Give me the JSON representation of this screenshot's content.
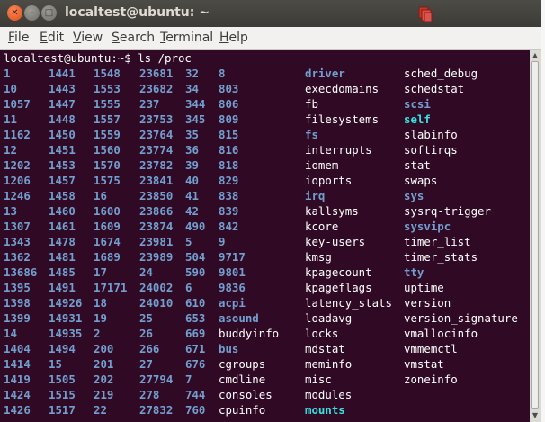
{
  "window": {
    "title": "localtest@ubuntu: ~",
    "close_symbol": "✕",
    "minimize_symbol": "–",
    "maximize_symbol": "□"
  },
  "menu": [
    {
      "id": "file",
      "prefix": "",
      "ul": "F",
      "rest": "ile"
    },
    {
      "id": "edit",
      "prefix": "",
      "ul": "E",
      "rest": "dit"
    },
    {
      "id": "view",
      "prefix": "",
      "ul": "V",
      "rest": "iew"
    },
    {
      "id": "search",
      "prefix": "",
      "ul": "S",
      "rest": "earch"
    },
    {
      "id": "terminal",
      "prefix": "",
      "ul": "T",
      "rest": "erminal"
    },
    {
      "id": "help",
      "prefix": "",
      "ul": "H",
      "rest": "elp"
    }
  ],
  "terminal": {
    "prompt": "localtest@ubuntu:~$ ls /proc",
    "colors": {
      "background": "#300a24",
      "text": "#ffffff",
      "directory": "#729fcf",
      "link": "#34e2e2"
    },
    "rows": [
      [
        [
          "1",
          "d"
        ],
        [
          "1441",
          "d"
        ],
        [
          "1548",
          "d"
        ],
        [
          "23681",
          "d"
        ],
        [
          "32",
          "d"
        ],
        [
          "8",
          "d"
        ],
        [
          "driver",
          "d"
        ],
        [
          "sched_debug",
          "f"
        ]
      ],
      [
        [
          "10",
          "d"
        ],
        [
          "1443",
          "d"
        ],
        [
          "1553",
          "d"
        ],
        [
          "23682",
          "d"
        ],
        [
          "34",
          "d"
        ],
        [
          "803",
          "d"
        ],
        [
          "execdomains",
          "f"
        ],
        [
          "schedstat",
          "f"
        ]
      ],
      [
        [
          "1057",
          "d"
        ],
        [
          "1447",
          "d"
        ],
        [
          "1555",
          "d"
        ],
        [
          "237",
          "d"
        ],
        [
          "344",
          "d"
        ],
        [
          "806",
          "d"
        ],
        [
          "fb",
          "f"
        ],
        [
          "scsi",
          "d"
        ]
      ],
      [
        [
          "11",
          "d"
        ],
        [
          "1448",
          "d"
        ],
        [
          "1557",
          "d"
        ],
        [
          "23753",
          "d"
        ],
        [
          "345",
          "d"
        ],
        [
          "809",
          "d"
        ],
        [
          "filesystems",
          "f"
        ],
        [
          "self",
          "l"
        ]
      ],
      [
        [
          "1162",
          "d"
        ],
        [
          "1450",
          "d"
        ],
        [
          "1559",
          "d"
        ],
        [
          "23764",
          "d"
        ],
        [
          "35",
          "d"
        ],
        [
          "815",
          "d"
        ],
        [
          "fs",
          "d"
        ],
        [
          "slabinfo",
          "f"
        ]
      ],
      [
        [
          "12",
          "d"
        ],
        [
          "1451",
          "d"
        ],
        [
          "1560",
          "d"
        ],
        [
          "23774",
          "d"
        ],
        [
          "36",
          "d"
        ],
        [
          "816",
          "d"
        ],
        [
          "interrupts",
          "f"
        ],
        [
          "softirqs",
          "f"
        ]
      ],
      [
        [
          "1202",
          "d"
        ],
        [
          "1453",
          "d"
        ],
        [
          "1570",
          "d"
        ],
        [
          "23782",
          "d"
        ],
        [
          "39",
          "d"
        ],
        [
          "818",
          "d"
        ],
        [
          "iomem",
          "f"
        ],
        [
          "stat",
          "f"
        ]
      ],
      [
        [
          "1206",
          "d"
        ],
        [
          "1457",
          "d"
        ],
        [
          "1575",
          "d"
        ],
        [
          "23841",
          "d"
        ],
        [
          "40",
          "d"
        ],
        [
          "829",
          "d"
        ],
        [
          "ioports",
          "f"
        ],
        [
          "swaps",
          "f"
        ]
      ],
      [
        [
          "1246",
          "d"
        ],
        [
          "1458",
          "d"
        ],
        [
          "16",
          "d"
        ],
        [
          "23850",
          "d"
        ],
        [
          "41",
          "d"
        ],
        [
          "838",
          "d"
        ],
        [
          "irq",
          "d"
        ],
        [
          "sys",
          "d"
        ]
      ],
      [
        [
          "13",
          "d"
        ],
        [
          "1460",
          "d"
        ],
        [
          "1600",
          "d"
        ],
        [
          "23866",
          "d"
        ],
        [
          "42",
          "d"
        ],
        [
          "839",
          "d"
        ],
        [
          "kallsyms",
          "f"
        ],
        [
          "sysrq-trigger",
          "f"
        ]
      ],
      [
        [
          "1307",
          "d"
        ],
        [
          "1461",
          "d"
        ],
        [
          "1609",
          "d"
        ],
        [
          "23874",
          "d"
        ],
        [
          "490",
          "d"
        ],
        [
          "842",
          "d"
        ],
        [
          "kcore",
          "f"
        ],
        [
          "sysvipc",
          "d"
        ]
      ],
      [
        [
          "1343",
          "d"
        ],
        [
          "1478",
          "d"
        ],
        [
          "1674",
          "d"
        ],
        [
          "23981",
          "d"
        ],
        [
          "5",
          "d"
        ],
        [
          "9",
          "d"
        ],
        [
          "key-users",
          "f"
        ],
        [
          "timer_list",
          "f"
        ]
      ],
      [
        [
          "1362",
          "d"
        ],
        [
          "1481",
          "d"
        ],
        [
          "1689",
          "d"
        ],
        [
          "23989",
          "d"
        ],
        [
          "504",
          "d"
        ],
        [
          "9717",
          "d"
        ],
        [
          "kmsg",
          "f"
        ],
        [
          "timer_stats",
          "f"
        ]
      ],
      [
        [
          "13686",
          "d"
        ],
        [
          "1485",
          "d"
        ],
        [
          "17",
          "d"
        ],
        [
          "24",
          "d"
        ],
        [
          "590",
          "d"
        ],
        [
          "9801",
          "d"
        ],
        [
          "kpagecount",
          "f"
        ],
        [
          "tty",
          "d"
        ]
      ],
      [
        [
          "1395",
          "d"
        ],
        [
          "1491",
          "d"
        ],
        [
          "17171",
          "d"
        ],
        [
          "24002",
          "d"
        ],
        [
          "6",
          "d"
        ],
        [
          "9836",
          "d"
        ],
        [
          "kpageflags",
          "f"
        ],
        [
          "uptime",
          "f"
        ]
      ],
      [
        [
          "1398",
          "d"
        ],
        [
          "14926",
          "d"
        ],
        [
          "18",
          "d"
        ],
        [
          "24010",
          "d"
        ],
        [
          "610",
          "d"
        ],
        [
          "acpi",
          "d"
        ],
        [
          "latency_stats",
          "f"
        ],
        [
          "version",
          "f"
        ]
      ],
      [
        [
          "1399",
          "d"
        ],
        [
          "14931",
          "d"
        ],
        [
          "19",
          "d"
        ],
        [
          "25",
          "d"
        ],
        [
          "653",
          "d"
        ],
        [
          "asound",
          "d"
        ],
        [
          "loadavg",
          "f"
        ],
        [
          "version_signature",
          "f"
        ]
      ],
      [
        [
          "14",
          "d"
        ],
        [
          "14935",
          "d"
        ],
        [
          "2",
          "d"
        ],
        [
          "26",
          "d"
        ],
        [
          "669",
          "d"
        ],
        [
          "buddyinfo",
          "f"
        ],
        [
          "locks",
          "f"
        ],
        [
          "vmallocinfo",
          "f"
        ]
      ],
      [
        [
          "1404",
          "d"
        ],
        [
          "1494",
          "d"
        ],
        [
          "200",
          "d"
        ],
        [
          "266",
          "d"
        ],
        [
          "671",
          "d"
        ],
        [
          "bus",
          "d"
        ],
        [
          "mdstat",
          "f"
        ],
        [
          "vmmemctl",
          "f"
        ]
      ],
      [
        [
          "1414",
          "d"
        ],
        [
          "15",
          "d"
        ],
        [
          "201",
          "d"
        ],
        [
          "27",
          "d"
        ],
        [
          "676",
          "d"
        ],
        [
          "cgroups",
          "f"
        ],
        [
          "meminfo",
          "f"
        ],
        [
          "vmstat",
          "f"
        ]
      ],
      [
        [
          "1419",
          "d"
        ],
        [
          "1505",
          "d"
        ],
        [
          "202",
          "d"
        ],
        [
          "27794",
          "d"
        ],
        [
          "7",
          "d"
        ],
        [
          "cmdline",
          "f"
        ],
        [
          "misc",
          "f"
        ],
        [
          "zoneinfo",
          "f"
        ]
      ],
      [
        [
          "1424",
          "d"
        ],
        [
          "1515",
          "d"
        ],
        [
          "219",
          "d"
        ],
        [
          "278",
          "d"
        ],
        [
          "744",
          "d"
        ],
        [
          "consoles",
          "f"
        ],
        [
          "modules",
          "f"
        ],
        [
          "",
          "f"
        ]
      ],
      [
        [
          "1426",
          "d"
        ],
        [
          "1517",
          "d"
        ],
        [
          "22",
          "d"
        ],
        [
          "27832",
          "d"
        ],
        [
          "760",
          "d"
        ],
        [
          "cpuinfo",
          "f"
        ],
        [
          "mounts",
          "l"
        ],
        [
          "",
          "f"
        ]
      ]
    ]
  },
  "scrollbar": {
    "up_arrow": "▲",
    "down_arrow": "▼"
  }
}
